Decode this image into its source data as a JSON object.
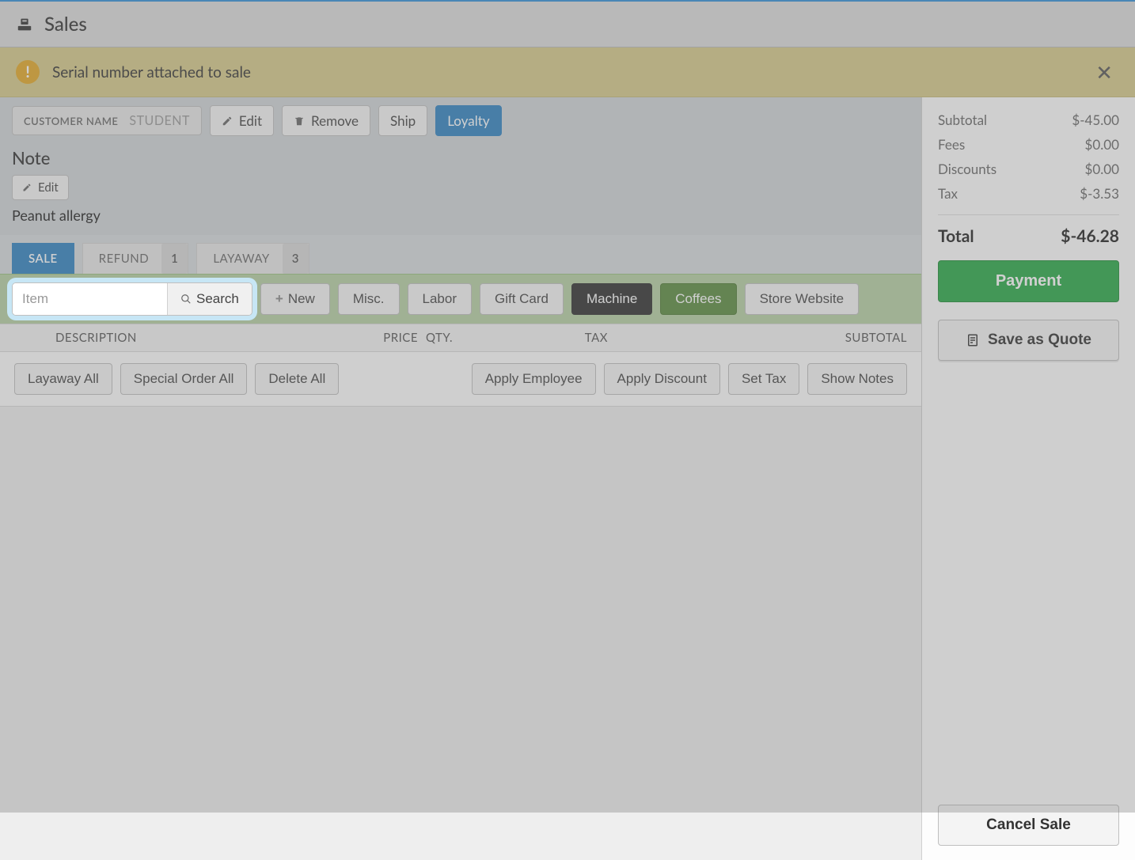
{
  "header": {
    "title": "Sales"
  },
  "alert": {
    "message": "Serial number attached to sale"
  },
  "customer": {
    "label": "CUSTOMER NAME",
    "value": "STUDENT",
    "edit": "Edit",
    "remove": "Remove",
    "ship": "Ship",
    "loyalty": "Loyalty"
  },
  "note": {
    "heading": "Note",
    "edit": "Edit",
    "text": "Peanut allergy"
  },
  "tabs": {
    "sale": "SALE",
    "refund": "REFUND",
    "refund_count": "1",
    "layaway": "LAYAWAY",
    "layaway_count": "3"
  },
  "item_toolbar": {
    "placeholder": "Item",
    "search": "Search",
    "new": "New",
    "misc": "Misc.",
    "labor": "Labor",
    "giftcard": "Gift Card",
    "machine": "Machine",
    "coffees": "Coffees",
    "store": "Store Website"
  },
  "table": {
    "description": "DESCRIPTION",
    "price": "PRICE",
    "qty": "QTY.",
    "tax": "TAX",
    "subtotal": "SUBTOTAL"
  },
  "actions": {
    "layaway_all": "Layaway All",
    "special_order_all": "Special Order All",
    "delete_all": "Delete All",
    "apply_employee": "Apply Employee",
    "apply_discount": "Apply Discount",
    "set_tax": "Set Tax",
    "show_notes": "Show Notes"
  },
  "totals": {
    "subtotal_label": "Subtotal",
    "subtotal_value": "$-45.00",
    "fees_label": "Fees",
    "fees_value": "$0.00",
    "discounts_label": "Discounts",
    "discounts_value": "$0.00",
    "tax_label": "Tax",
    "tax_value": "$-3.53",
    "total_label": "Total",
    "total_value": "$-46.28"
  },
  "sidebar_buttons": {
    "payment": "Payment",
    "save_quote": "Save as Quote",
    "cancel": "Cancel Sale"
  }
}
